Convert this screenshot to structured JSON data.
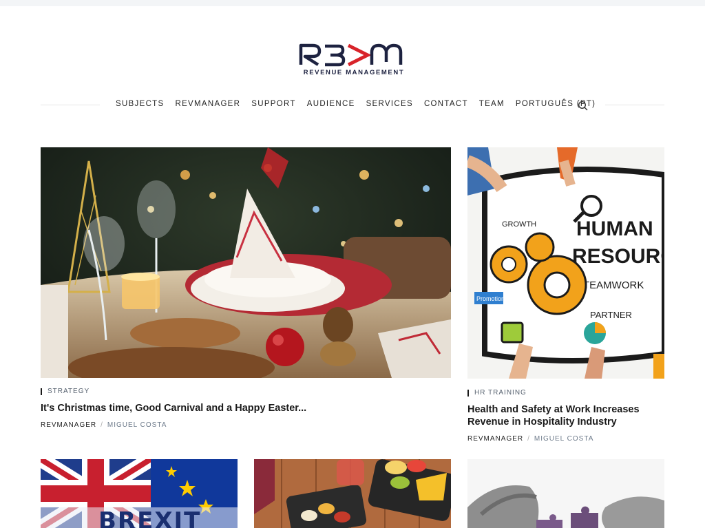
{
  "brand": {
    "logo_text": "R3>M",
    "tagline": "REVENUE MANAGEMENT",
    "colors": {
      "navy": "#1d2240",
      "red": "#d8232a"
    }
  },
  "nav": {
    "items": [
      "SUBJECTS",
      "REVMANAGER",
      "SUPPORT",
      "AUDIENCE",
      "SERVICES",
      "CONTACT",
      "TEAM",
      "PORTUGUÊS (PT)"
    ],
    "search_icon": "search-icon"
  },
  "posts": [
    {
      "category": "STRATEGY",
      "title": "It's Christmas time, Good Carnival and a Happy Easter...",
      "author_label": "REVMANAGER",
      "author": "MIGUEL COSTA",
      "image": "christmas-table-image"
    },
    {
      "category": "HR TRAINING",
      "title": "Health and Safety at Work Increases Revenue in Hospitality Industry",
      "author_label": "REVMANAGER",
      "author": "MIGUEL COSTA",
      "image": "human-resources-image"
    },
    {
      "image": "brexit-image",
      "image_text": "BREXIT"
    },
    {
      "image": "food-table-image"
    },
    {
      "image": "puzzle-hands-image"
    }
  ]
}
